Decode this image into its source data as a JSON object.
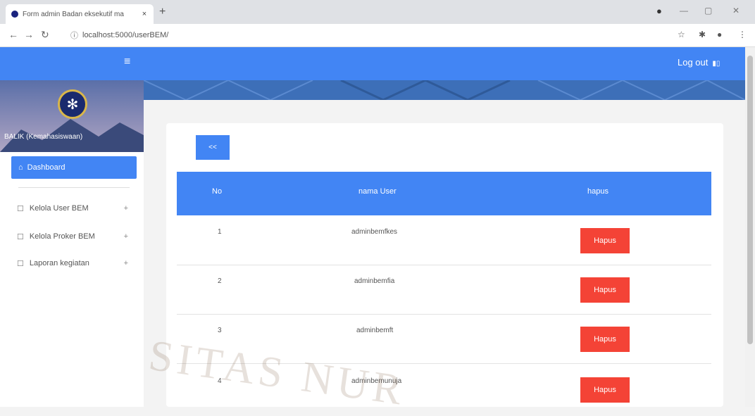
{
  "browser": {
    "tab_title": "Form admin Badan eksekutif ma",
    "tab_close": "×",
    "new_tab": "+",
    "url": "localhost:5000/userBEM/",
    "win_min": "—",
    "win_max": "▢",
    "win_close": "✕"
  },
  "header": {
    "menu_icon": "≡",
    "logout_label": "Log out"
  },
  "sidebar": {
    "org_name": "BALIK (Kemahasiswaan)",
    "active_item": "Dashboard",
    "items": [
      {
        "label": "Kelola User BEM",
        "expand": "+"
      },
      {
        "label": "Kelola Proker BEM",
        "expand": "+"
      },
      {
        "label": "Laporan kegiatan",
        "expand": "+"
      }
    ]
  },
  "content": {
    "back_label": "<<",
    "columns": [
      "No",
      "nama User",
      "hapus"
    ],
    "rows": [
      {
        "no": "1",
        "user": "adminbemfkes",
        "action": "Hapus"
      },
      {
        "no": "2",
        "user": "adminbemfia",
        "action": "Hapus"
      },
      {
        "no": "3",
        "user": "adminbemft",
        "action": "Hapus"
      },
      {
        "no": "4",
        "user": "adminbemunuja",
        "action": "Hapus"
      }
    ]
  },
  "watermark": "SITAS NUR",
  "colors": {
    "primary": "#4285f4",
    "danger": "#f44336",
    "banner": "#3d6fb8"
  }
}
